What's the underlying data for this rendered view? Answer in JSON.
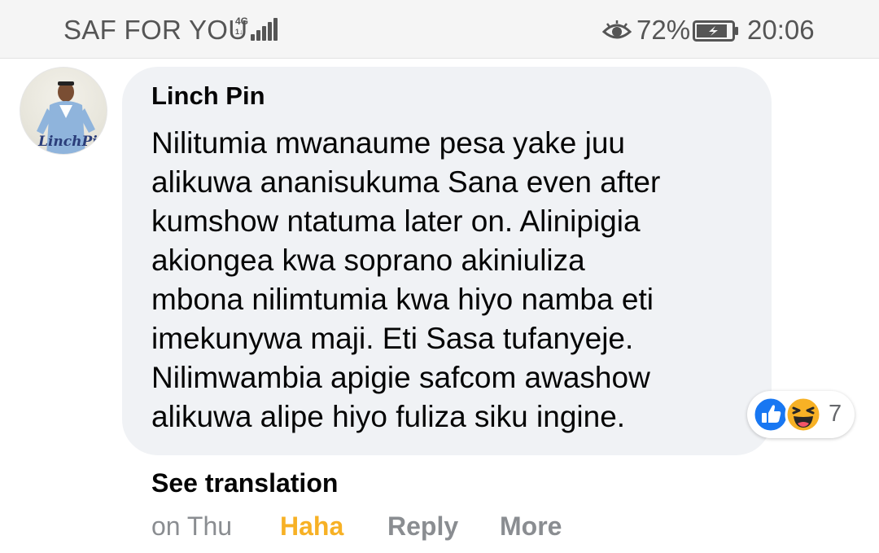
{
  "status_bar": {
    "carrier": "SAF FOR YOU",
    "network_type": "4G",
    "network_sub": "1↓",
    "battery_percent": "72%",
    "time": "20:06",
    "icons": [
      "signal-icon",
      "eye-comfort-icon",
      "battery-charging-icon"
    ]
  },
  "comment": {
    "avatar_text": "LinchPin",
    "author": "Linch Pin",
    "text": "Nilitumia mwanaume pesa yake juu\nalikuwa ananisukuma Sana even after\nkumshow ntatuma later on. Alinipigia\nakiongea kwa soprano akiniuliza\nmbona nilimtumia kwa hiyo namba eti\nimekunywa maji. Eti Sasa tufanyeje.\nNilimwambia apigie safcom awashow\nalikuwa alipe hiyo fuliza siku ingine.",
    "reactions": {
      "icons": [
        "like-icon",
        "haha-icon"
      ],
      "count": "7"
    },
    "see_translation": "See translation",
    "timestamp": "on Thu",
    "actions": {
      "haha": "Haha",
      "reply": "Reply",
      "more": "More"
    }
  },
  "colors": {
    "bubble": "#f0f2f5",
    "like_blue": "#1877f2",
    "haha_yellow": "#f7b125",
    "meta_gray": "#8a8d91"
  }
}
